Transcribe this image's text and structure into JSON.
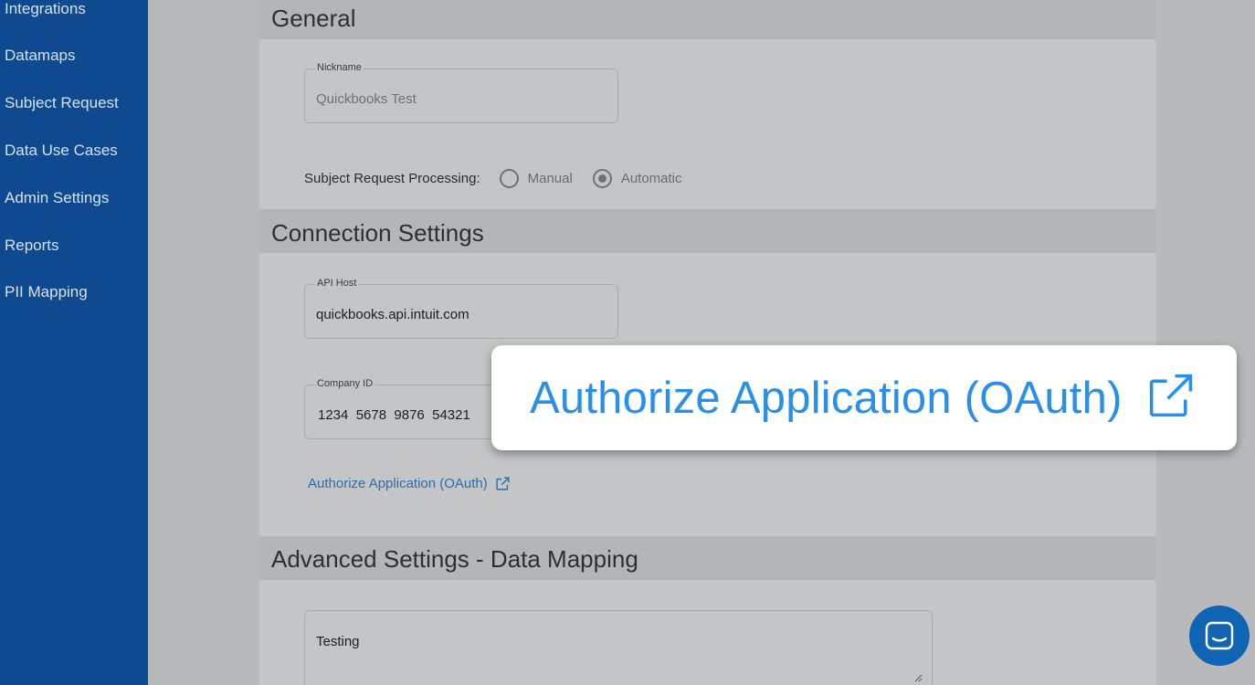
{
  "sidebar": {
    "items": [
      {
        "label": "Integrations"
      },
      {
        "label": "Datamaps"
      },
      {
        "label": "Subject Request"
      },
      {
        "label": "Data Use Cases"
      },
      {
        "label": "Admin Settings"
      },
      {
        "label": "Reports"
      },
      {
        "label": "PII Mapping"
      }
    ]
  },
  "general": {
    "title": "General",
    "nickname": {
      "label": "Nickname",
      "value": "Quickbooks Test"
    },
    "processing": {
      "label": "Subject Request Processing:",
      "options": [
        {
          "label": "Manual",
          "selected": false
        },
        {
          "label": "Automatic",
          "selected": true
        }
      ]
    }
  },
  "connection": {
    "title": "Connection Settings",
    "api_host": {
      "label": "API Host",
      "value": "quickbooks.api.intuit.com"
    },
    "company_id": {
      "label": "Company ID",
      "value": "1234  5678  9876  54321"
    },
    "oauth_link": "Authorize Application (OAuth)"
  },
  "advanced": {
    "title": "Advanced Settings - Data Mapping",
    "textarea_value": "Testing"
  },
  "callout": {
    "text": "Authorize Application (OAuth)",
    "icon": "external-link-icon"
  },
  "chat": {
    "icon": "chat-icon"
  },
  "colors": {
    "sidebar": "#0f4a90",
    "link": "#2d6ea8",
    "callout_text": "#2a8fe6",
    "chat": "#1064b4"
  }
}
